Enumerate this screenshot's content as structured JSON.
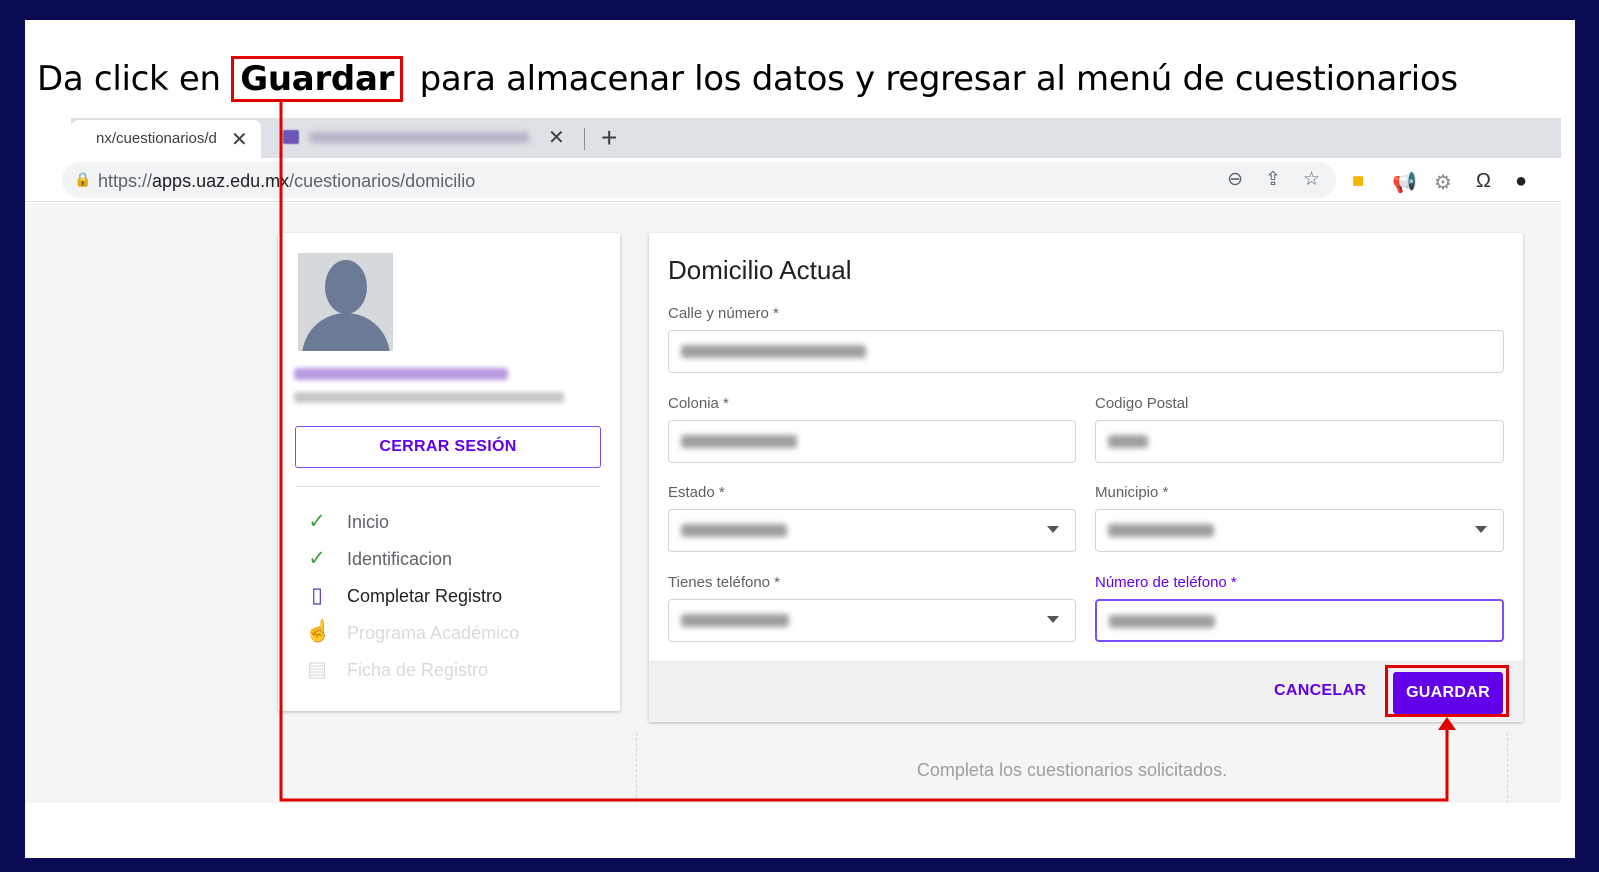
{
  "instruction": {
    "before": "Da click en",
    "keyword": "Guardar",
    "after": "para almacenar los datos y regresar al menú de cuestionarios"
  },
  "browser": {
    "tab_active_title": "nx/cuestionarios/d",
    "tab_close_glyph": "✕",
    "new_tab_glyph": "+",
    "url_prefix": "https://",
    "url_domain": "apps.uaz.edu.mx",
    "url_path": "/cuestionarios/domicilio",
    "icons": [
      "zoom-icon",
      "share-icon",
      "star-icon",
      "extension-icons"
    ]
  },
  "sidebar": {
    "logout_label": "CERRAR SESIÓN",
    "steps": [
      {
        "label": "Inicio",
        "state": "done",
        "icon": "✓"
      },
      {
        "label": "Identificacion",
        "state": "done",
        "icon": "✓"
      },
      {
        "label": "Completar Registro",
        "state": "current",
        "icon": "▯"
      },
      {
        "label": "Programa Académico",
        "state": "disabled",
        "icon": "☝"
      },
      {
        "label": "Ficha de Registro",
        "state": "disabled",
        "icon": "▤"
      }
    ]
  },
  "form": {
    "title": "Domicilio Actual",
    "labels": {
      "calle": "Calle y número *",
      "colonia": "Colonia *",
      "cp": "Codigo Postal",
      "estado": "Estado *",
      "municipio": "Municipio *",
      "tiene_tel": "Tienes teléfono *",
      "num_tel": "Número de teléfono *"
    },
    "cancel_label": "CANCELAR",
    "save_label": "GUARDAR"
  },
  "footer_msg": "Completa los cuestionarios solicitados.",
  "colors": {
    "accent": "#6200ea",
    "highlight": "#e00000",
    "background": "#0b0b55"
  }
}
